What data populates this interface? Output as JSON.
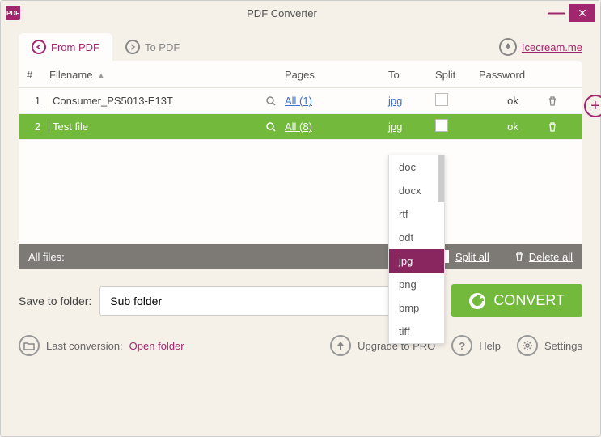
{
  "window": {
    "title": "PDF Converter"
  },
  "tabs": {
    "from": "From PDF",
    "to": "To PDF"
  },
  "brand": "Icecream.me",
  "headers": {
    "num": "#",
    "filename": "Filename",
    "pages": "Pages",
    "to": "To",
    "split": "Split",
    "password": "Password"
  },
  "rows": [
    {
      "num": "1",
      "filename": "Consumer_PS5013-E13T",
      "pages": "All (1)",
      "to": "jpg",
      "pwd": "ok"
    },
    {
      "num": "2",
      "filename": "Test file",
      "pages": "All (8)",
      "to": "jpg",
      "pwd": "ok"
    }
  ],
  "footer": {
    "all": "All files:",
    "split_all": "Split all",
    "delete_all": "Delete all"
  },
  "save": {
    "label": "Save to folder:",
    "value": "Sub folder"
  },
  "convert": "CONVERT",
  "bottom": {
    "last": "Last conversion:",
    "open": "Open folder",
    "upgrade": "Upgrade to PRO",
    "help": "Help",
    "settings": "Settings"
  },
  "dropdown": [
    "doc",
    "docx",
    "rtf",
    "odt",
    "jpg",
    "png",
    "bmp",
    "tiff"
  ],
  "dropdown_selected": "jpg"
}
